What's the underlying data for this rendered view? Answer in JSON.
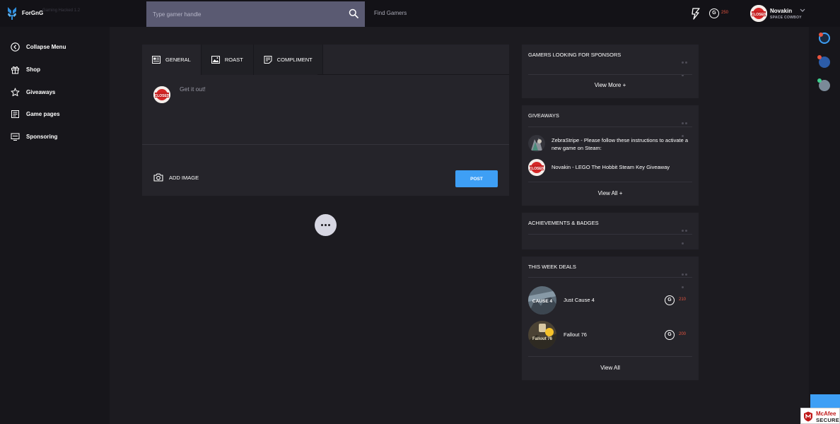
{
  "app": {
    "brand": "ForGnG",
    "brand_ghost": "Gaming Hacked 1.2"
  },
  "topbar": {
    "search_placeholder": "Type gamer handle",
    "find_gamers": "Find Gamers",
    "coin_symbol": "G",
    "coins": "250",
    "user_name": "Novakin",
    "user_subtitle": "SPACE COWBOY",
    "avatar_badge": "CLOSED"
  },
  "sidebar": {
    "items": [
      {
        "label": "Collapse Menu",
        "icon": "chevron-left-circle-icon"
      },
      {
        "label": "Shop",
        "icon": "gift-icon"
      },
      {
        "label": "Giveaways",
        "icon": "star-icon"
      },
      {
        "label": "Game pages",
        "icon": "document-icon"
      },
      {
        "label": "Sponsoring",
        "icon": "monitor-icon"
      }
    ]
  },
  "composer": {
    "tabs": [
      {
        "label": "GENERAL",
        "icon": "newspaper-icon"
      },
      {
        "label": "ROAST",
        "icon": "image-icon"
      },
      {
        "label": "COMPLIMENT",
        "icon": "note-icon"
      }
    ],
    "placeholder": "Get it out!",
    "add_image": "ADD IMAGE",
    "post": "POST"
  },
  "widgets": {
    "sponsors": {
      "title": "GAMERS LOOKING FOR SPONSORS",
      "link": "View More +"
    },
    "giveaways": {
      "title": "GIVEAWAYS",
      "items": [
        {
          "text": "ZebraStripe - Please follow these instructions to activate a new game on Steam:"
        },
        {
          "text": "Novakin - LEGO The Hobbit Steam Key Giveaway"
        }
      ],
      "link": "View All +"
    },
    "achievements": {
      "title": "ACHIEVEMENTS & BADGES"
    },
    "deals": {
      "title": "THIS WEEK DEALS",
      "items": [
        {
          "name": "Just Cause 4",
          "price": "210",
          "cover_text": "CAUSE 4"
        },
        {
          "name": "Fallout 76",
          "price": "200",
          "cover_text": "Fallout 76"
        }
      ],
      "coin_symbol": "G",
      "link": "View All"
    }
  },
  "footer": {
    "mcafee_name": "McAfee",
    "mcafee_secure": "SECURE"
  },
  "colors": {
    "accent": "#3e9ff5",
    "coin_price": "#e8543f",
    "background": "#1c1b20",
    "panel": "#25242a"
  }
}
